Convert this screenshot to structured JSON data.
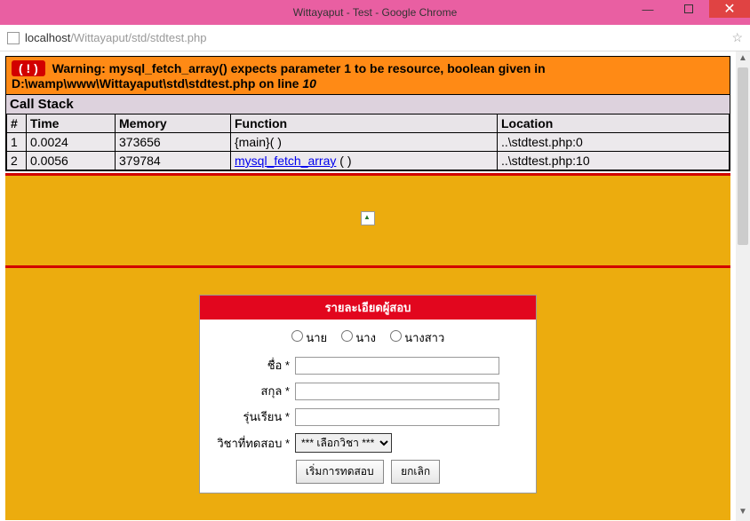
{
  "window": {
    "title": "Wittayaput - Test - Google Chrome",
    "min": "—",
    "close": "✕"
  },
  "address": {
    "domain": "localhost",
    "path": "/Wittayaput/std/stdtest.php"
  },
  "error": {
    "icon": "( ! )",
    "prefix": "Warning: mysql_fetch_array() expects parameter 1 to be resource, boolean given in D:\\wamp\\www\\Wittayaput\\std\\stdtest.php on line ",
    "line": "10"
  },
  "callstack": {
    "title": "Call Stack",
    "headers": {
      "num": "#",
      "time": "Time",
      "memory": "Memory",
      "function": "Function",
      "location": "Location"
    },
    "rows": [
      {
        "num": "1",
        "time": "0.0024",
        "memory": "373656",
        "function": "{main}( )",
        "funcIsLink": false,
        "location": "..\\stdtest.php:0"
      },
      {
        "num": "2",
        "time": "0.0056",
        "memory": "379784",
        "function": "mysql_fetch_array",
        "funcSuffix": " ( )",
        "funcIsLink": true,
        "location": "..\\stdtest.php:10"
      }
    ]
  },
  "form": {
    "header": "รายละเอียดผู้สอบ",
    "radios": {
      "r1": "นาย",
      "r2": "นาง",
      "r3": "นางสาว"
    },
    "labels": {
      "name": "ชื่อ *",
      "surname": "สกุล *",
      "batch": "รุ่นเรียน *",
      "subject": "วิชาที่ทดสอบ *"
    },
    "select": "*** เลือกวิชา ***",
    "buttons": {
      "start": "เริ่มการทดสอบ",
      "cancel": "ยกเลิก"
    }
  }
}
